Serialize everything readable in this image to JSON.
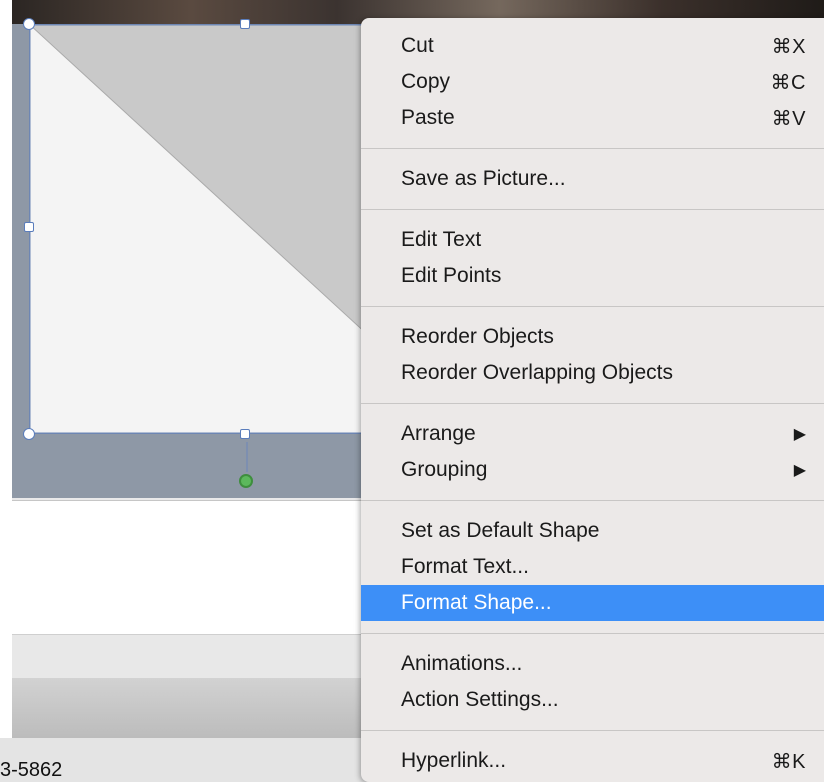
{
  "context_menu": {
    "groups": [
      [
        {
          "label": "Cut",
          "shortcut": "⌘X"
        },
        {
          "label": "Copy",
          "shortcut": "⌘C"
        },
        {
          "label": "Paste",
          "shortcut": "⌘V"
        }
      ],
      [
        {
          "label": "Save as Picture..."
        }
      ],
      [
        {
          "label": "Edit Text"
        },
        {
          "label": "Edit Points"
        }
      ],
      [
        {
          "label": "Reorder Objects"
        },
        {
          "label": "Reorder Overlapping Objects"
        }
      ],
      [
        {
          "label": "Arrange",
          "submenu_icon": "▶"
        },
        {
          "label": "Grouping",
          "submenu_icon": "▶"
        }
      ],
      [
        {
          "label": "Set as Default Shape"
        },
        {
          "label": "Format Text..."
        },
        {
          "label": "Format Shape...",
          "highlighted": true
        }
      ],
      [
        {
          "label": "Animations..."
        },
        {
          "label": "Action Settings..."
        }
      ],
      [
        {
          "label": "Hyperlink...",
          "shortcut": "⌘K"
        }
      ]
    ]
  },
  "background": {
    "phone_fragment": "3-5862"
  },
  "colors": {
    "highlight": "#3d8ff7",
    "selection_handles": "#5a7dbc",
    "rotate_handle": "#5cb85c"
  }
}
